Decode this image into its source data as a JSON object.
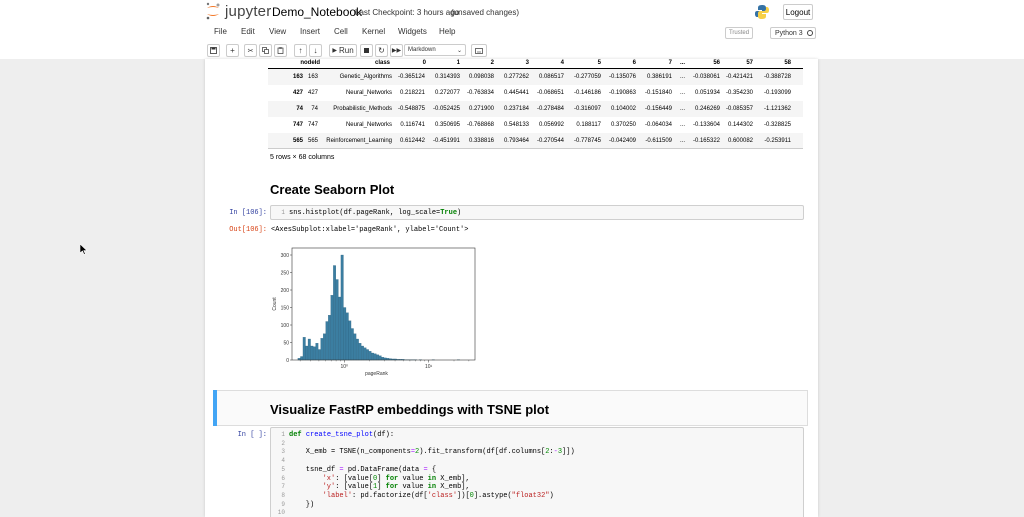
{
  "header": {
    "brand": "jupyter",
    "notebook_name": "Demo_Notebook",
    "checkpoint": "Last Checkpoint: 3 hours ago",
    "unsaved": "(unsaved changes)",
    "logout_label": "Logout"
  },
  "menubar": {
    "items": [
      "File",
      "Edit",
      "View",
      "Insert",
      "Cell",
      "Kernel",
      "Widgets",
      "Help"
    ],
    "trusted_label": "Trusted",
    "kernel_label": "Python 3"
  },
  "toolbar": {
    "run_label": "Run",
    "cell_type": "Markdown"
  },
  "dataframe": {
    "columns": [
      "nodeId",
      "class",
      "0",
      "1",
      "2",
      "3",
      "4",
      "5",
      "6",
      "7",
      "...",
      "56",
      "57",
      "58"
    ],
    "rows": [
      [
        "163",
        "163",
        "Genetic_Algorithms",
        "-0.365124",
        "0.314393",
        "0.098038",
        "0.277262",
        "0.086517",
        "-0.277059",
        "-0.135076",
        "0.386191",
        "...",
        "-0.038061",
        "-0.421421",
        "-0.388728"
      ],
      [
        "427",
        "427",
        "Neural_Networks",
        "0.218221",
        "0.272077",
        "-0.763834",
        "0.445441",
        "-0.068651",
        "-0.146186",
        "-0.190863",
        "-0.151840",
        "...",
        "0.051934",
        "-0.354230",
        "-0.193099"
      ],
      [
        "74",
        "74",
        "Probabilistic_Methods",
        "-0.548875",
        "-0.052425",
        "0.271900",
        "0.237184",
        "-0.278484",
        "-0.316097",
        "0.104002",
        "-0.156449",
        "...",
        "0.246269",
        "-0.085357",
        "-1.121362"
      ],
      [
        "747",
        "747",
        "Neural_Networks",
        "0.116741",
        "0.350695",
        "-0.768868",
        "0.548133",
        "0.056992",
        "0.188117",
        "0.370250",
        "-0.064034",
        "...",
        "-0.133604",
        "0.144302",
        "-0.328825"
      ],
      [
        "565",
        "565",
        "Reinforcement_Learning",
        "0.612442",
        "-0.451991",
        "0.338816",
        "0.793464",
        "-0.270544",
        "-0.778745",
        "-0.042409",
        "-0.611509",
        "...",
        "-0.165322",
        "0.600082",
        "-0.253911"
      ]
    ],
    "shape_text": "5 rows × 68 columns"
  },
  "cells": {
    "heading1": "Create Seaborn Plot",
    "in106_prompt": "In [106]:",
    "in106_lineno": "1",
    "in106_code_a": "sns.histplot(df.pageRank, log_scale=",
    "in106_code_true": "True",
    "in106_code_b": ")",
    "out106_prompt": "Out[106]:",
    "out106_text": "<AxesSubplot:xlabel='pageRank', ylabel='Count'>",
    "heading2": "Visualize FastRP embeddings with TSNE plot",
    "in_blank_prompt": "In [ ]:",
    "code_lines": [
      {
        "n": "1",
        "parts": [
          [
            "kw",
            "def "
          ],
          [
            "fn",
            "create_tsne_plot"
          ],
          [
            "",
            "(df):"
          ]
        ]
      },
      {
        "n": "2",
        "parts": []
      },
      {
        "n": "3",
        "parts": [
          [
            "",
            "    X_emb = TSNE(n_components"
          ],
          [
            "op",
            "="
          ],
          [
            "num",
            "2"
          ],
          [
            "",
            ").fit_transform(df[df.columns["
          ],
          [
            "num",
            "2"
          ],
          [
            "",
            ":"
          ],
          [
            "op",
            "-"
          ],
          [
            "num",
            "3"
          ],
          [
            "",
            "]])"
          ]
        ]
      },
      {
        "n": "4",
        "parts": []
      },
      {
        "n": "5",
        "parts": [
          [
            "",
            "    tsne_df "
          ],
          [
            "op",
            "="
          ],
          [
            "",
            " pd.DataFrame(data "
          ],
          [
            "op",
            "="
          ],
          [
            "",
            " {"
          ]
        ]
      },
      {
        "n": "6",
        "parts": [
          [
            "",
            "        "
          ],
          [
            "str",
            "'x'"
          ],
          [
            "",
            ": [value["
          ],
          [
            "num",
            "0"
          ],
          [
            "",
            "] "
          ],
          [
            "kwc",
            "for"
          ],
          [
            "",
            " value "
          ],
          [
            "kwc",
            "in"
          ],
          [
            "",
            " X_emb],"
          ]
        ]
      },
      {
        "n": "7",
        "parts": [
          [
            "",
            "        "
          ],
          [
            "str",
            "'y'"
          ],
          [
            "",
            ": [value["
          ],
          [
            "num",
            "1"
          ],
          [
            "",
            "] "
          ],
          [
            "kwc",
            "for"
          ],
          [
            "",
            " value "
          ],
          [
            "kwc",
            "in"
          ],
          [
            "",
            " X_emb],"
          ]
        ]
      },
      {
        "n": "8",
        "parts": [
          [
            "",
            "        "
          ],
          [
            "str",
            "'label'"
          ],
          [
            "",
            ": pd.factorize(df["
          ],
          [
            "str",
            "'class'"
          ],
          [
            "",
            "])["
          ],
          [
            "num",
            "0"
          ],
          [
            "",
            "].astype("
          ],
          [
            "str",
            "\"float32\""
          ],
          [
            "",
            ")"
          ]
        ]
      },
      {
        "n": "9",
        "parts": [
          [
            "",
            "    })"
          ]
        ]
      },
      {
        "n": "10",
        "parts": []
      }
    ]
  },
  "chart_data": {
    "type": "bar",
    "xlabel": "pageRank",
    "ylabel": "Count",
    "x_scale": "log",
    "xtick_labels": [
      "10⁰",
      "10¹"
    ],
    "ytick_labels": [
      "0",
      "50",
      "100",
      "150",
      "200",
      "250",
      "300"
    ],
    "ylim": [
      0,
      320
    ],
    "bin_edges_log10": [
      -0.55,
      -0.52,
      -0.49,
      -0.46,
      -0.43,
      -0.4,
      -0.37,
      -0.34,
      -0.31,
      -0.28,
      -0.25,
      -0.22,
      -0.19,
      -0.16,
      -0.13,
      -0.1,
      -0.07,
      -0.04,
      -0.01,
      0.02,
      0.05,
      0.08,
      0.11,
      0.14,
      0.17,
      0.2,
      0.23,
      0.26,
      0.29,
      0.32,
      0.35,
      0.38,
      0.41,
      0.44,
      0.47,
      0.5,
      0.53,
      0.56,
      0.59,
      0.62,
      0.65,
      0.68,
      0.71,
      0.74,
      0.77,
      0.8,
      0.83,
      0.86,
      0.89,
      0.92,
      0.95,
      0.98,
      1.01,
      1.04,
      1.07,
      1.1,
      1.13,
      1.16,
      1.19,
      1.22,
      1.25,
      1.28,
      1.31,
      1.34,
      1.37,
      1.4
    ],
    "counts": [
      5,
      10,
      65,
      40,
      60,
      40,
      38,
      48,
      30,
      62,
      75,
      110,
      128,
      185,
      270,
      230,
      180,
      300,
      150,
      135,
      112,
      90,
      75,
      60,
      48,
      40,
      35,
      30,
      25,
      20,
      18,
      15,
      12,
      8,
      6,
      5,
      4,
      3,
      3,
      2,
      2,
      2,
      1,
      1,
      1,
      1,
      1,
      0,
      1,
      0,
      0,
      0,
      0,
      1,
      0,
      0,
      0,
      0,
      0,
      0,
      0,
      0,
      0,
      1,
      0
    ],
    "bar_color": "#3b7ea1"
  },
  "colors": {
    "accent_selected": "#42a5f5",
    "in_prompt": "#303f9f",
    "out_prompt": "#d84315"
  }
}
